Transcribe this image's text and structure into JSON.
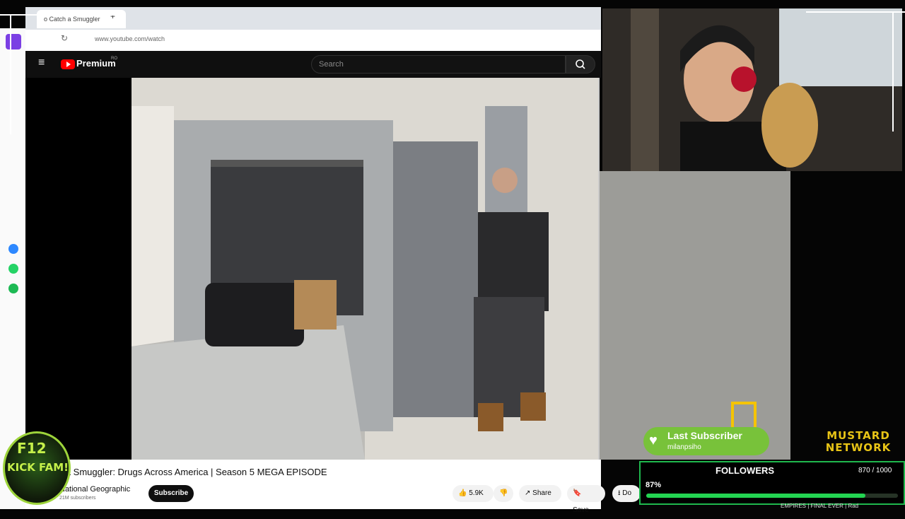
{
  "browser": {
    "tab_title": "o Catch a Smuggler",
    "new_tab": "+",
    "url": "www.youtube.com/watch"
  },
  "youtube": {
    "logo_text": "Premium",
    "logo_region": "RO",
    "search_placeholder": "Search",
    "brand_color": "#ff0000"
  },
  "video": {
    "title": "h a Smuggler: Drugs Across America | Season 5 MEGA EPISODE",
    "channel": "National Geographic",
    "subscribers": "21M subscribers",
    "subscribe_label": "Subscribe",
    "likes": "5.9K",
    "share_label": "Share",
    "save_label": "Save",
    "download_label": "Do"
  },
  "overlay": {
    "badge_line1": "F12",
    "badge_line2": "KICK FAM!",
    "last_sub_title": "Last Subscriber",
    "last_sub_name": "milanpsiho",
    "network_line1": "MUSTARD",
    "network_line2": "NETWORK",
    "followers_title": "FOLLOWERS",
    "followers_count": "870 / 1000",
    "followers_pct": "87%",
    "followers_fraction": 0.87,
    "ticker": "EMPIRES | FINAL EVER | Rad",
    "accent_green": "#23d552",
    "accent_yellow": "#e8c416"
  }
}
